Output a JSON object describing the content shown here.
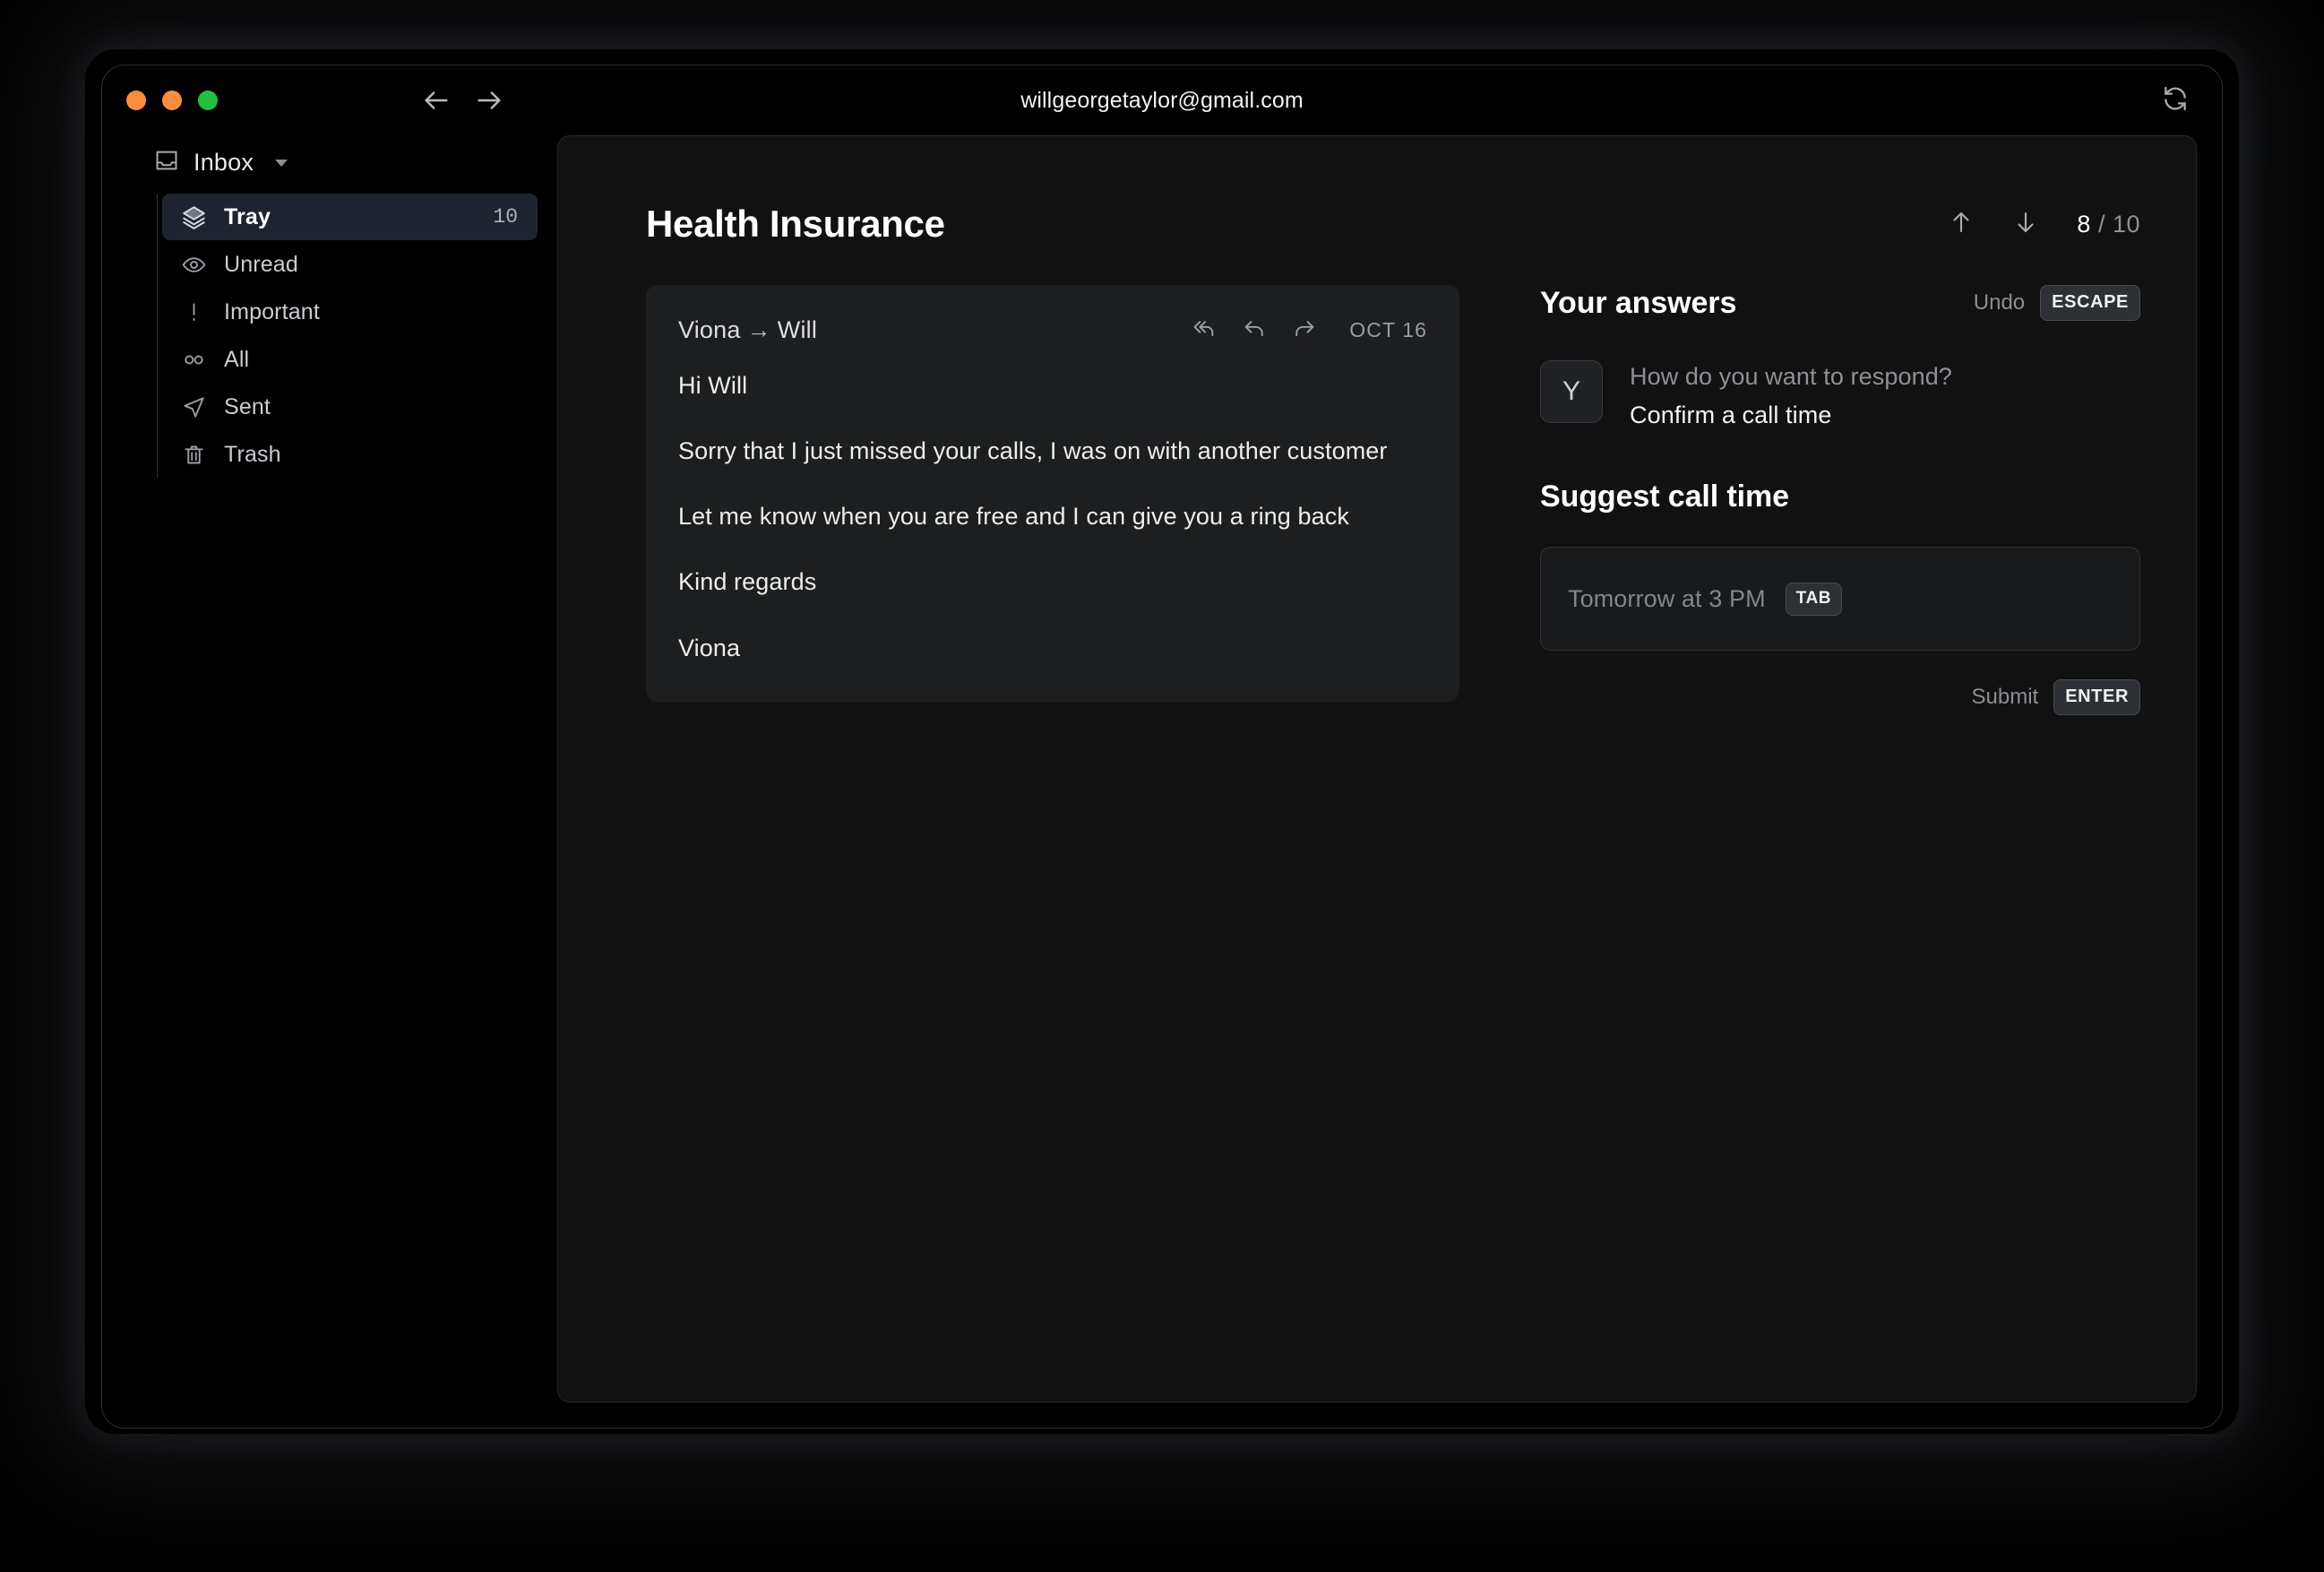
{
  "window": {
    "account_email": "willgeorgetaylor@gmail.com",
    "traffic_lights": [
      "close-orange",
      "minimize-orange",
      "maximize-green"
    ],
    "back_icon": "arrow-left-icon",
    "forward_icon": "arrow-right-icon",
    "refresh_icon": "refresh-icon"
  },
  "sidebar": {
    "header": {
      "label": "Inbox",
      "icon": "inbox-tray-icon",
      "caret": "chevron-down-icon"
    },
    "items": [
      {
        "label": "Tray",
        "icon": "layers-icon",
        "count": "10",
        "active": true
      },
      {
        "label": "Unread",
        "icon": "eye-icon",
        "count": "",
        "active": false
      },
      {
        "label": "Important",
        "icon": "exclamation-icon",
        "count": "",
        "active": false
      },
      {
        "label": "All",
        "icon": "infinity-icon",
        "count": "",
        "active": false
      },
      {
        "label": "Sent",
        "icon": "send-icon",
        "count": "",
        "active": false
      },
      {
        "label": "Trash",
        "icon": "trash-icon",
        "count": "",
        "active": false
      }
    ]
  },
  "main": {
    "subject": "Health Insurance",
    "nav": {
      "up_icon": "arrow-up-icon",
      "down_icon": "arrow-down-icon",
      "current": "8",
      "separator": " / ",
      "total": "10"
    }
  },
  "email": {
    "from": "Viona",
    "arrow": "→",
    "to": "Will",
    "date": "OCT 16",
    "actions": [
      {
        "name": "reply-all-icon"
      },
      {
        "name": "reply-icon"
      },
      {
        "name": "forward-icon"
      }
    ],
    "paragraphs": [
      "Hi Will",
      "Sorry that I just missed your calls, I was on with another customer",
      "Let me know when you are free and I can give you a ring back",
      "Kind regards",
      "Viona"
    ]
  },
  "answers": {
    "title": "Your answers",
    "undo_label": "Undo",
    "undo_key": "ESCAPE",
    "selected": {
      "key": "Y",
      "question": "How do you want to respond?",
      "answer": "Confirm a call time"
    },
    "suggest": {
      "title": "Suggest call time",
      "placeholder": "Tomorrow at 3 PM",
      "autocomplete_key": "TAB",
      "submit_label": "Submit",
      "submit_key": "ENTER"
    }
  },
  "colors": {
    "window_bg": "#000000",
    "panel_bg": "#111112",
    "card_bg": "#1d1e20",
    "active_item_bg": "#1e242f",
    "accent_orange": "#fd8e3f",
    "accent_green": "#23c03f",
    "text_primary": "#ffffff",
    "text_muted": "#8e9196"
  }
}
